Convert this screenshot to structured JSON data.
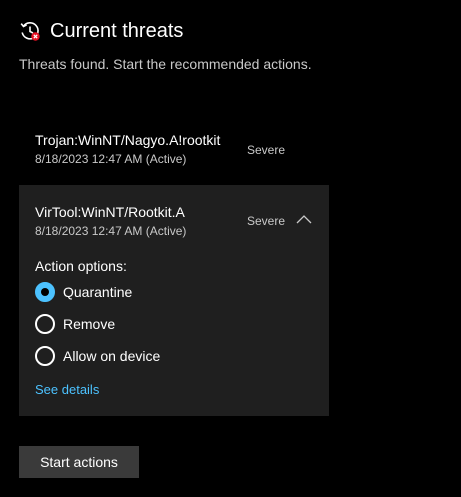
{
  "header": {
    "icon": "history-warning-icon",
    "title": "Current threats",
    "subtitle": "Threats found. Start the recommended actions."
  },
  "threats": [
    {
      "name": "Trojan:WinNT/Nagyo.A!rootkit",
      "date": "8/18/2023 12:47 AM (Active)",
      "severity": "Severe",
      "expanded": false
    },
    {
      "name": "VirTool:WinNT/Rootkit.A",
      "date": "8/18/2023 12:47 AM (Active)",
      "severity": "Severe",
      "expanded": true,
      "action_options_label": "Action options:",
      "options": [
        {
          "label": "Quarantine",
          "selected": true
        },
        {
          "label": "Remove",
          "selected": false
        },
        {
          "label": "Allow on device",
          "selected": false
        }
      ],
      "see_details": "See details"
    }
  ],
  "start_actions_label": "Start actions",
  "colors": {
    "accent": "#4cc2ff",
    "background": "#000000",
    "card": "#1f1f1f",
    "button": "#3a3a3a",
    "alert": "#e81123"
  }
}
